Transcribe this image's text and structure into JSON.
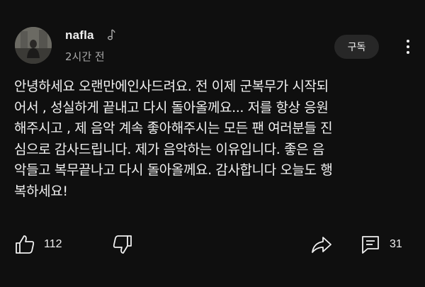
{
  "post": {
    "channel_name": "nafla",
    "time_ago": "2시간 전",
    "subscribe_label": "구독",
    "body_lines": [
      "안녕하세요 오랜만에인사드려요. 전 이제 군복무가 시작되",
      "어서 , 성실하게 끝내고 다시 돌아올께요... 저를 항상 응원",
      "해주시고 , 제 음악 계속 좋아해주시는 모든 팬 여러분들 진",
      "심으로 감사드립니다. 제가 음악하는 이유입니다. 좋은 음",
      "악들고 복무끝나고 다시 돌아올께요. 감사합니다 오늘도 행",
      "복하세요!"
    ]
  },
  "actions": {
    "like_count": "112",
    "comment_count": "31"
  },
  "icons": {
    "verified": "music-note-icon",
    "like": "thumbs-up-icon",
    "dislike": "thumbs-down-icon",
    "share": "share-icon",
    "comment": "comment-icon",
    "more": "more-vertical-icon"
  },
  "colors": {
    "background": "#0f0f0f",
    "text": "#f1f1f1",
    "secondary_text": "#aaaaaa",
    "button_bg": "#272727"
  }
}
